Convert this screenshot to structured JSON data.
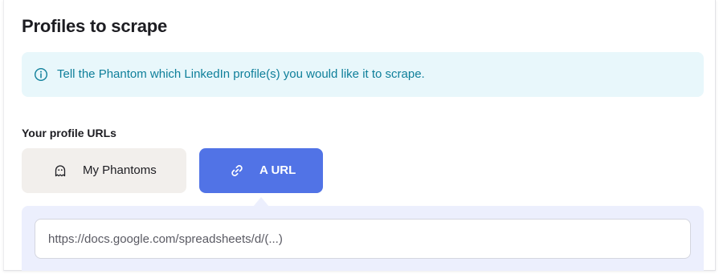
{
  "section": {
    "title": "Profiles to scrape"
  },
  "info": {
    "icon": "info-icon",
    "text": "Tell the Phantom which LinkedIn profile(s) you would like it to scrape."
  },
  "field": {
    "label": "Your profile URLs"
  },
  "tabs": [
    {
      "label": "My Phantoms",
      "icon": "ghost-icon",
      "selected": false
    },
    {
      "label": "A URL",
      "icon": "link-icon",
      "selected": true
    }
  ],
  "url_input": {
    "value": "",
    "placeholder": "https://docs.google.com/spreadsheets/d/(...)"
  },
  "colors": {
    "accent": "#5173e6",
    "info_bg": "#e8f7fb",
    "info_text": "#0e7f9a",
    "tab_inactive_bg": "#f2efec",
    "panel_bg": "#eceffd"
  }
}
